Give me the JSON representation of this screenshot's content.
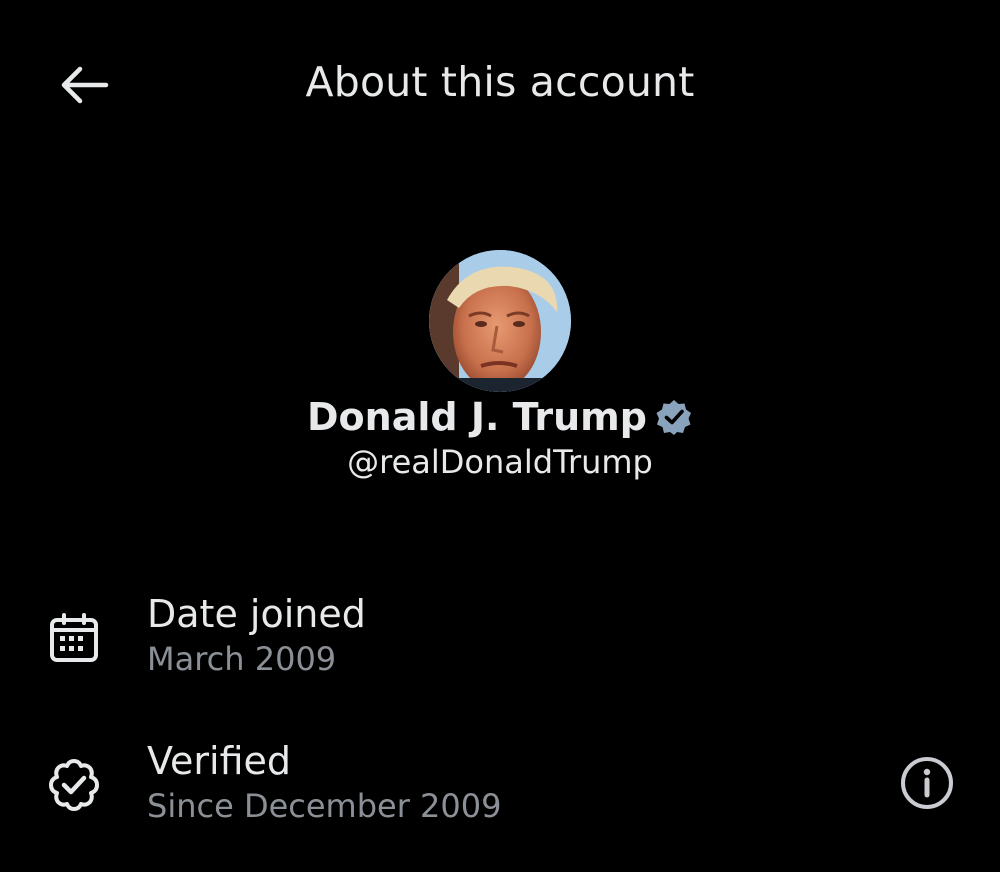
{
  "header": {
    "title": "About this account",
    "back_icon": "arrow-left-icon"
  },
  "profile": {
    "display_name": "Donald J. Trump",
    "handle": "@realDonaldTrump",
    "verified_icon": "verified-badge-icon",
    "badge_color": "#8aa3bd"
  },
  "rows": [
    {
      "icon": "calendar-icon",
      "label": "Date joined",
      "value": "March 2009"
    },
    {
      "icon": "verified-check-icon",
      "label": "Verified",
      "value": "Since December 2009",
      "action_icon": "info-icon"
    }
  ],
  "colors": {
    "background": "#000000",
    "text_primary": "#e7e9ea",
    "text_secondary": "#8b9097"
  }
}
